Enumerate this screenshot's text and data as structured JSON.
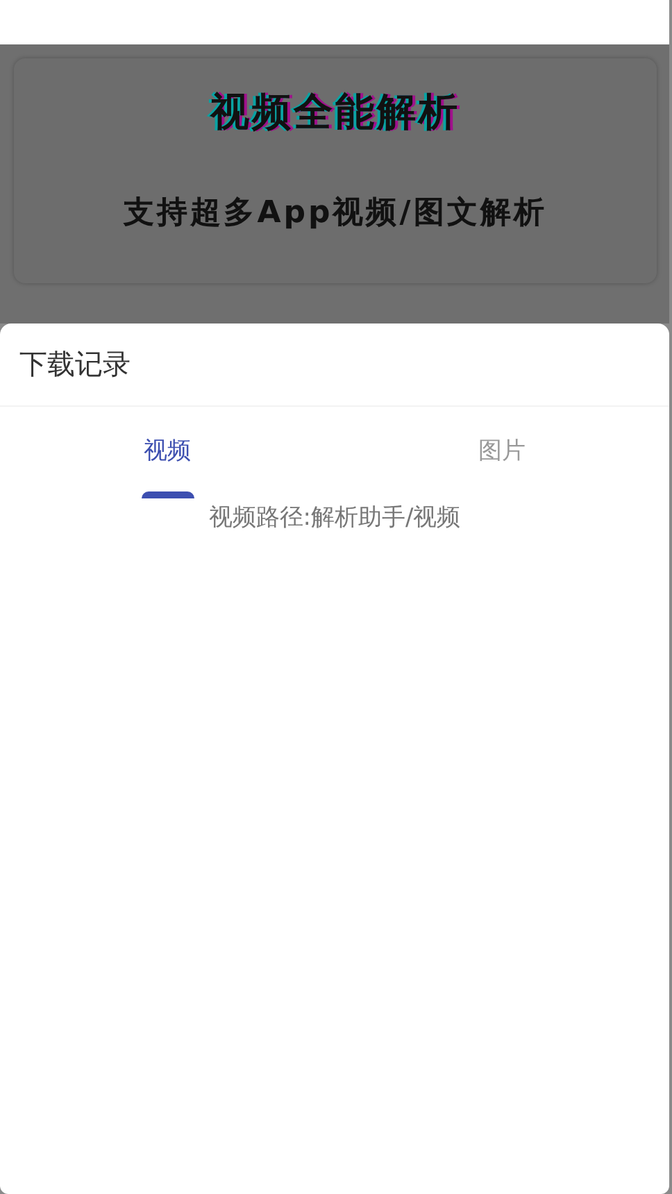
{
  "banner": {
    "title": "视频全能解析",
    "subtitle": "支持超多App视频/图文解析"
  },
  "sheet": {
    "title": "下载记录",
    "tabs": [
      {
        "label": "视频",
        "selected": true
      },
      {
        "label": "图片",
        "selected": false
      }
    ],
    "path_text": "视频路径:解析助手/视频"
  }
}
